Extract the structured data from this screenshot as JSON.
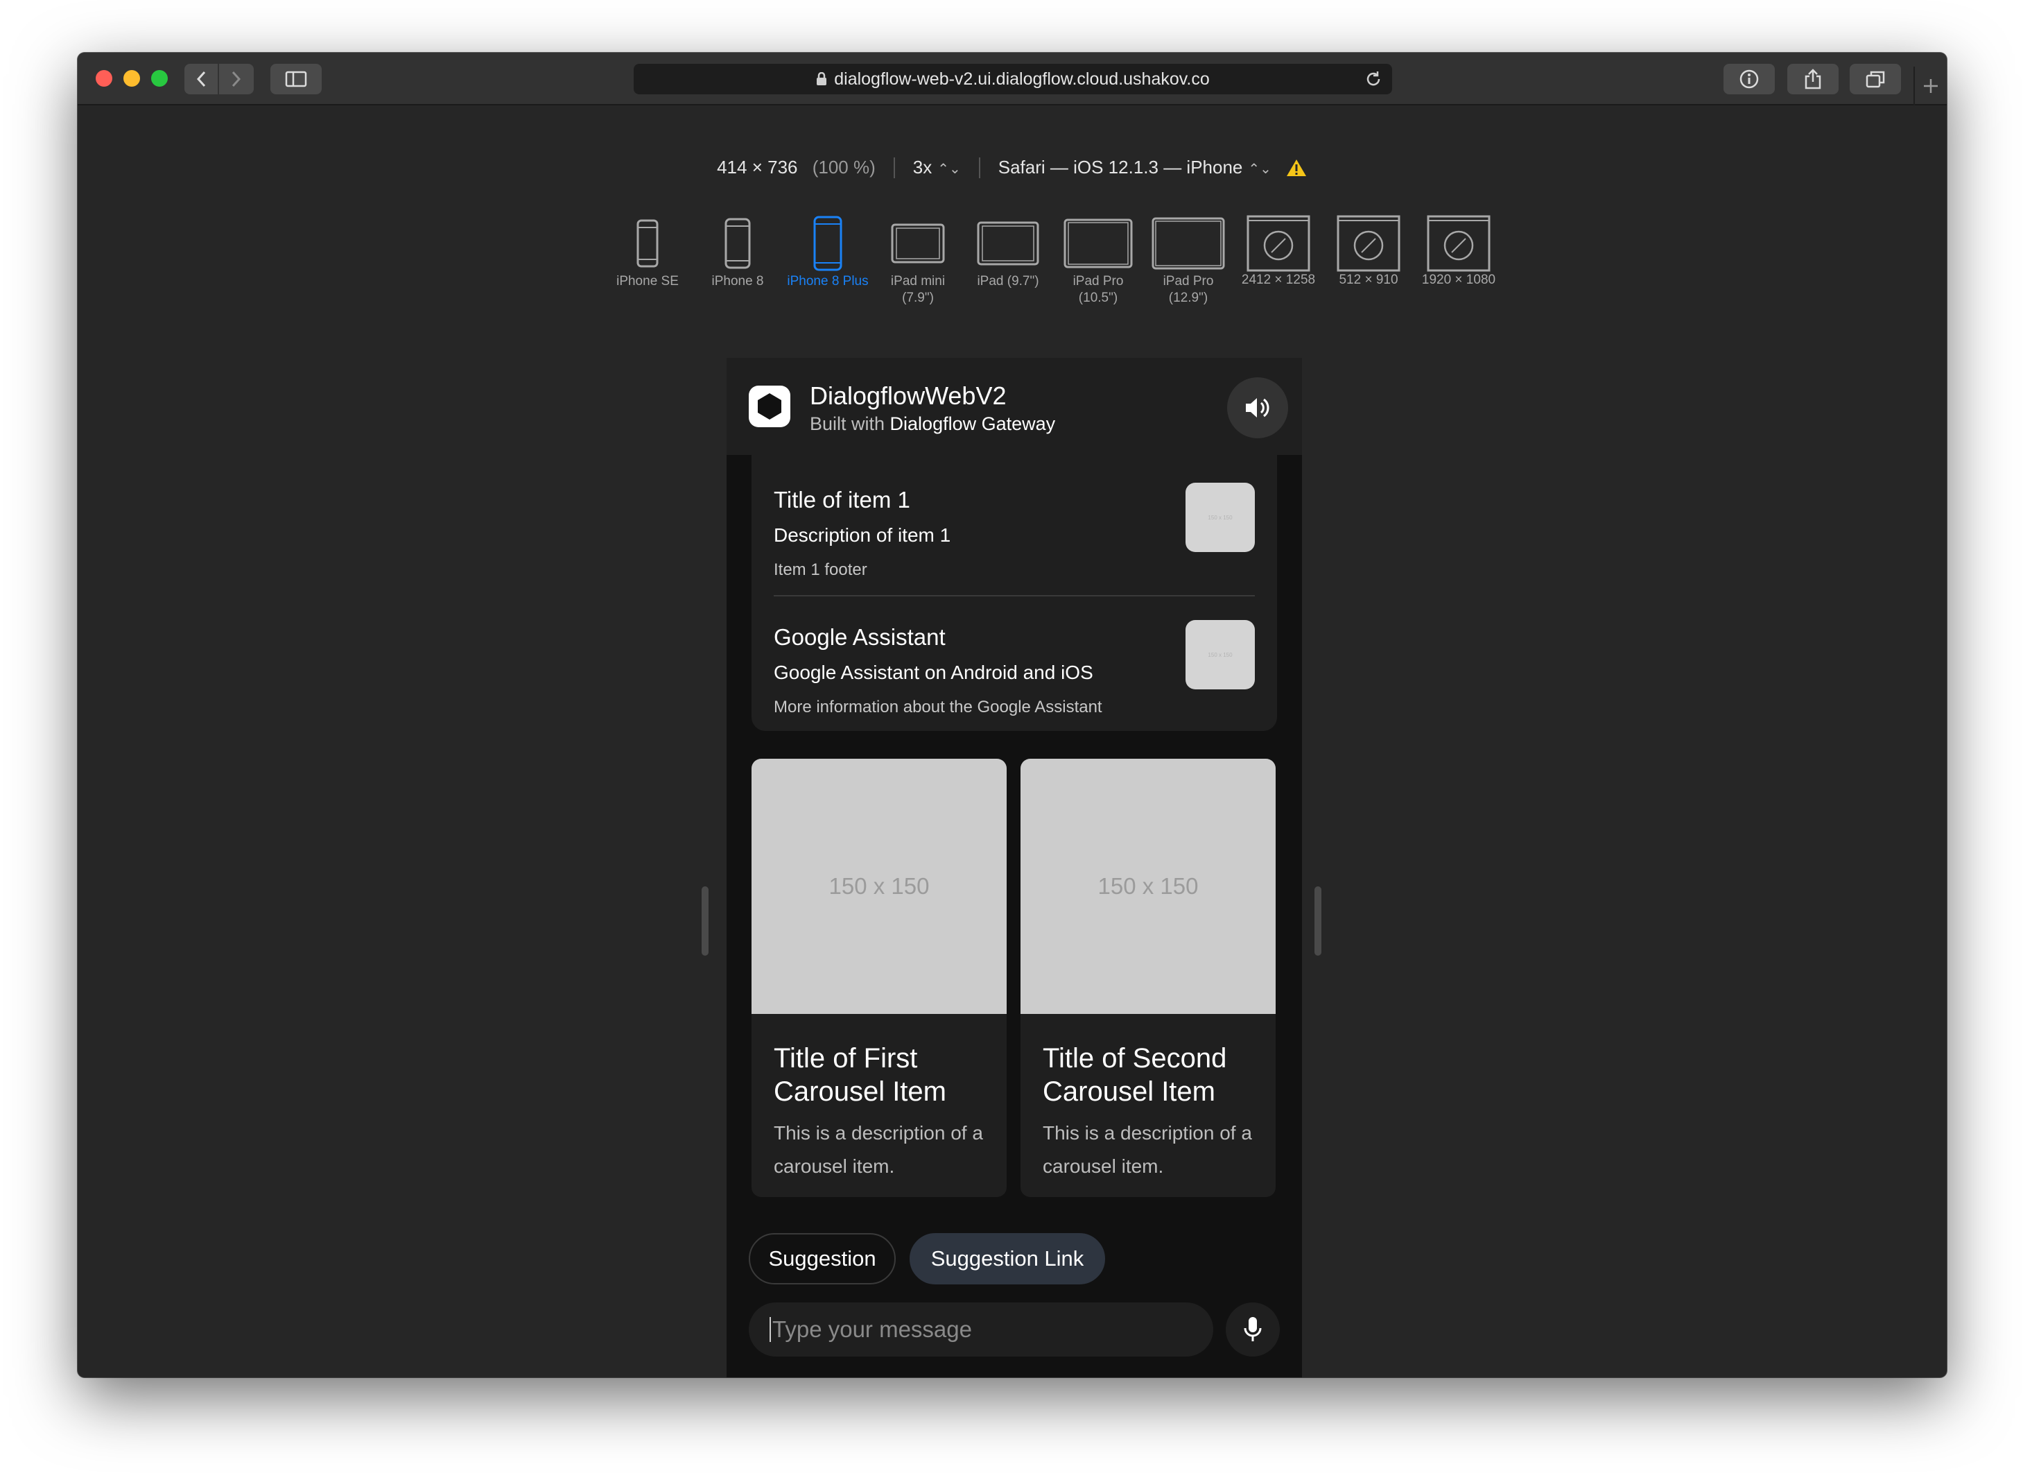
{
  "browser": {
    "url": "dialogflow-web-v2.ui.dialogflow.cloud.ushakov.co",
    "colors": {
      "close": "#ff5f57",
      "minimize": "#febc2e",
      "zoom": "#28c840"
    }
  },
  "rdm": {
    "size": "414 × 736",
    "percent": "(100 %)",
    "scale": "3x",
    "agent": "Safari — iOS 12.1.3 — iPhone"
  },
  "devices": [
    {
      "label": "iPhone SE",
      "icon": "phone-icon"
    },
    {
      "label": "iPhone 8",
      "icon": "phone-icon"
    },
    {
      "label": "iPhone 8 Plus",
      "icon": "phone-icon",
      "active": true,
      "accent": "#1a82f7"
    },
    {
      "label": "iPad mini (7.9\")",
      "icon": "tablet-icon"
    },
    {
      "label": "iPad (9.7\")",
      "icon": "tablet-icon"
    },
    {
      "label": "iPad Pro (10.5\")",
      "icon": "tablet-icon"
    },
    {
      "label": "iPad Pro (12.9\")",
      "icon": "tablet-icon"
    },
    {
      "label": "2412 × 1258",
      "icon": "compass-icon"
    },
    {
      "label": "512 × 910",
      "icon": "compass-icon"
    },
    {
      "label": "1920 × 1080",
      "icon": "compass-icon"
    }
  ],
  "app": {
    "title": "DialogflowWebV2",
    "subtitle_prefix": "Built with ",
    "subtitle_brand": "Dialogflow Gateway"
  },
  "list": [
    {
      "title": "Title of item 1",
      "description": "Description of item 1",
      "footer": "Item 1 footer",
      "image": "150 x 150"
    },
    {
      "title": "Google Assistant",
      "description": "Google Assistant on Android and iOS",
      "footer": "More information about the Google Assistant",
      "image": "150 x 150"
    }
  ],
  "carousel": [
    {
      "image": "150 x 150",
      "title": "Title of First Carousel Item",
      "description": "This is a description of a carousel item."
    },
    {
      "image": "150 x 150",
      "title": "Title of Second Carousel Item",
      "description": "This is a description of a carousel item."
    }
  ],
  "suggestions": [
    "Suggestion",
    "Suggestion Link"
  ],
  "input": {
    "placeholder": "Type your message"
  }
}
